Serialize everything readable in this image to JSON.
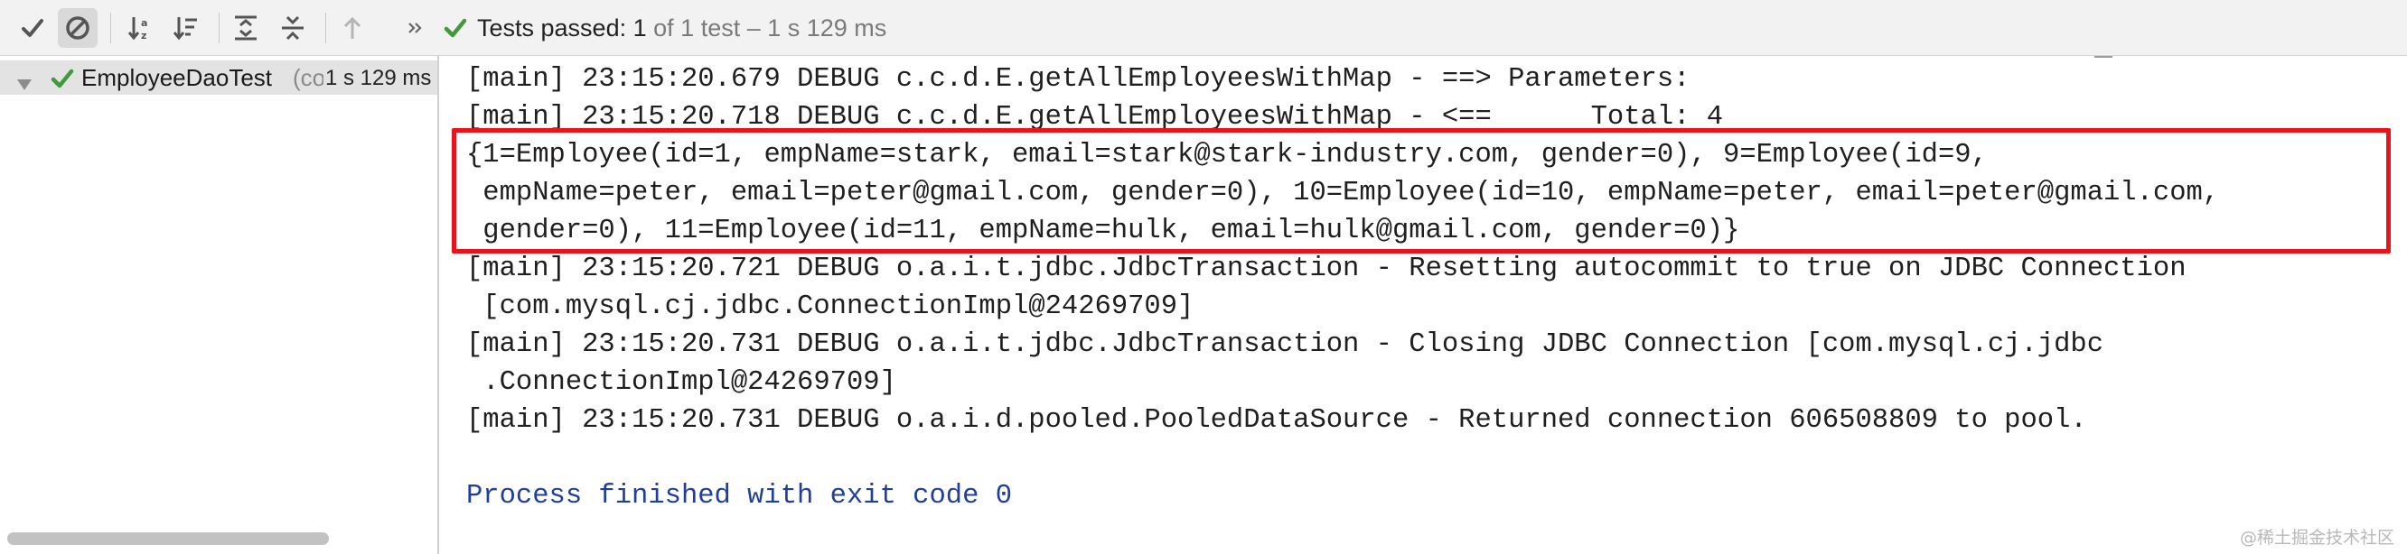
{
  "toolbar": {
    "buttons": [
      {
        "name": "show-passed-toggle",
        "icon": "checkmark-icon"
      },
      {
        "name": "show-ignored-toggle",
        "icon": "ignored-circle-icon"
      },
      {
        "name": "sort-alphabetically-button",
        "icon": "sort-alphabetically-icon"
      },
      {
        "name": "sort-by-duration-button",
        "icon": "sort-by-duration-icon"
      },
      {
        "name": "expand-all-button",
        "icon": "expand-all-icon"
      },
      {
        "name": "collapse-all-button",
        "icon": "collapse-all-icon"
      },
      {
        "name": "previous-failed-test-button",
        "icon": "arrow-up-icon"
      },
      {
        "name": "more-actions-button",
        "icon": "double-chevron-right-icon"
      }
    ],
    "status": {
      "label": "Tests passed:",
      "count": "1",
      "detail": "of 1 test – 1 s 129 ms"
    }
  },
  "tree": {
    "rows": [
      {
        "name": "EmployeeDaoTest",
        "package": "(co",
        "duration": "1 s 129 ms",
        "status": "passed"
      }
    ]
  },
  "console": {
    "lines": [
      "[main] 23:15:20.679 DEBUG c.c.d.E.getAllEmployeesWithMap - ==> Parameters:",
      "[main] 23:15:20.718 DEBUG c.c.d.E.getAllEmployeesWithMap - <==      Total: 4",
      "{1=Employee(id=1, empName=stark, email=stark@stark-industry.com, gender=0), 9=Employee(id=9,",
      " empName=peter, email=peter@gmail.com, gender=0), 10=Employee(id=10, empName=peter, email=peter@gmail.com,",
      " gender=0), 11=Employee(id=11, empName=hulk, email=hulk@gmail.com, gender=0)}",
      "[main] 23:15:20.721 DEBUG o.a.i.t.jdbc.JdbcTransaction - Resetting autocommit to true on JDBC Connection",
      " [com.mysql.cj.jdbc.ConnectionImpl@24269709]",
      "[main] 23:15:20.731 DEBUG o.a.i.t.jdbc.JdbcTransaction - Closing JDBC Connection [com.mysql.cj.jdbc",
      " .ConnectionImpl@24269709]",
      "[main] 23:15:20.731 DEBUG o.a.i.d.pooled.PooledDataSource - Returned connection 606508809 to pool.",
      "",
      "Process finished with exit code 0"
    ],
    "highlighted_lines": [
      2,
      3,
      4
    ]
  },
  "watermark": "@稀土掘金技术社区",
  "colors": {
    "pass_green": "#3f9a3c",
    "highlight_red": "#e8141a",
    "exit_text_blue": "#1f3f9f"
  }
}
